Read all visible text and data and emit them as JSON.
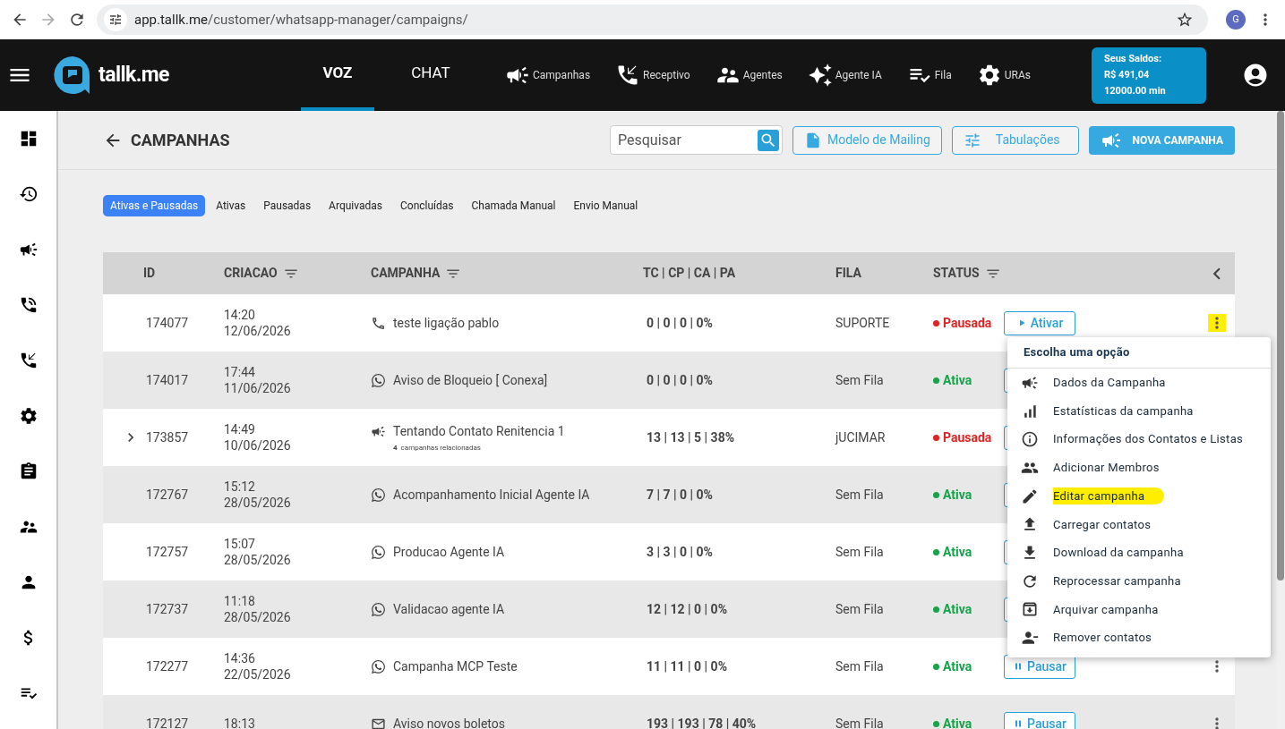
{
  "browser": {
    "url_host": "app.tallk.me",
    "url_path": "/customer/whatsapp-manager/campaigns/",
    "profile": "G"
  },
  "header": {
    "logo": "tallk.me",
    "modes": [
      {
        "label": "VOZ",
        "selected": true
      },
      {
        "label": "CHAT",
        "selected": false
      }
    ],
    "nav": [
      "Campanhas",
      "Receptivo",
      "Agentes",
      "Agente IA",
      "Fila",
      "URAs"
    ],
    "balance": {
      "title": "Seus Saldos:",
      "amount": "R$ 491,04",
      "minutes": "12000.00 min"
    }
  },
  "page": {
    "title": "CAMPANHAS",
    "search": {
      "placeholder": "Pesquisar"
    },
    "buttons": [
      "Modelo de Mailing",
      "Tabulações",
      "NOVA CAMPANHA"
    ]
  },
  "tabs": [
    {
      "label": "Ativas e Pausadas",
      "selected": true
    },
    {
      "label": "Ativas",
      "selected": false
    },
    {
      "label": "Pausadas",
      "selected": false
    },
    {
      "label": "Arquivadas",
      "selected": false
    },
    {
      "label": "Concluídas",
      "selected": false
    },
    {
      "label": "Chamada Manual",
      "selected": false
    },
    {
      "label": "Envio Manual",
      "selected": false
    }
  ],
  "table": {
    "columns": [
      "ID",
      "CRIACAO",
      "CAMPANHA",
      "TC | CP | CA | PA",
      "FILA",
      "STATUS"
    ],
    "rows": [
      {
        "id": "174077",
        "time": "14:20",
        "date": "12/06/2026",
        "kind": "phone",
        "name": "teste ligação pablo",
        "stats": "0 | 0 | 0 | 0%",
        "queue": "SUPORTE",
        "status": {
          "kind": "paused",
          "label": "Pausada"
        },
        "action": {
          "kind": "activate",
          "label": "Ativar"
        },
        "marked": true
      },
      {
        "id": "174017",
        "time": "17:44",
        "date": "11/06/2026",
        "kind": "whatsapp",
        "name": "Aviso de Bloqueio [ Conexa]",
        "stats": "0 | 0 | 0 | 0%",
        "queue": "Sem Fila",
        "status": {
          "kind": "active",
          "label": "Ativa"
        },
        "action": {
          "kind": "pause"
        }
      },
      {
        "id": "173857",
        "time": "14:49",
        "date": "10/06/2026",
        "kind": "megaphone",
        "name": "Tentando Contato Renitencia 1",
        "related": {
          "count": "4",
          "label": "campanhas relacionadas"
        },
        "stats": "13 | 13 | 5 | 38%",
        "queue": "jUCIMAR",
        "status": {
          "kind": "paused",
          "label": "Pausada"
        },
        "action": {
          "kind": "activate"
        }
      },
      {
        "id": "172767",
        "time": "15:12",
        "date": "28/05/2026",
        "kind": "whatsapp",
        "name": "Acompanhamento Inicial Agente IA",
        "stats": "7 | 7 | 0 | 0%",
        "queue": "Sem Fila",
        "status": {
          "kind": "active",
          "label": "Ativa"
        },
        "action": {
          "kind": "pause"
        }
      },
      {
        "id": "172757",
        "time": "15:07",
        "date": "28/05/2026",
        "kind": "whatsapp",
        "name": "Producao Agente IA",
        "stats": "3 | 3 | 0 | 0%",
        "queue": "Sem Fila",
        "status": {
          "kind": "active",
          "label": "Ativa"
        },
        "action": {
          "kind": "pause"
        }
      },
      {
        "id": "172737",
        "time": "11:18",
        "date": "28/05/2026",
        "kind": "whatsapp",
        "name": "Validacao agente IA",
        "stats": "12 | 12 | 0 | 0%",
        "queue": "Sem Fila",
        "status": {
          "kind": "active",
          "label": "Ativa"
        },
        "action": {
          "kind": "pause"
        }
      },
      {
        "id": "172277",
        "time": "14:36",
        "date": "22/05/2026",
        "kind": "whatsapp",
        "name": "Campanha MCP Teste",
        "stats": "11 | 11 | 0 | 0%",
        "queue": "Sem Fila",
        "status": {
          "kind": "active",
          "label": "Ativa"
        },
        "action": {
          "kind": "pause",
          "label": "Pausar"
        },
        "marked": false
      },
      {
        "id": "172127",
        "time": "18:13",
        "kind": "mail",
        "name": "Aviso novos boletos",
        "stats": "193 | 193 | 78 | 40%",
        "queue": "Sem Fila",
        "status": {
          "kind": "active",
          "label": "Ativa"
        },
        "action": {
          "kind": "pause",
          "label": "Pausar"
        },
        "marked": false
      }
    ]
  },
  "menu": {
    "title": "Escolha uma opção",
    "items": [
      {
        "label": "Dados da Campanha",
        "highlighted": false
      },
      {
        "label": "Estatísticas da campanha",
        "highlighted": false
      },
      {
        "label": "Informações dos Contatos e Listas",
        "highlighted": false
      },
      {
        "label": "Adicionar Membros",
        "highlighted": false
      },
      {
        "label": "Editar campanha",
        "highlighted": true
      },
      {
        "label": "Carregar contatos",
        "highlighted": false
      },
      {
        "label": "Download da campanha",
        "highlighted": false
      },
      {
        "label": "Reprocessar campanha",
        "highlighted": false
      },
      {
        "label": "Arquivar campanha",
        "highlighted": false
      },
      {
        "label": "Remover contatos",
        "highlighted": false
      }
    ]
  }
}
